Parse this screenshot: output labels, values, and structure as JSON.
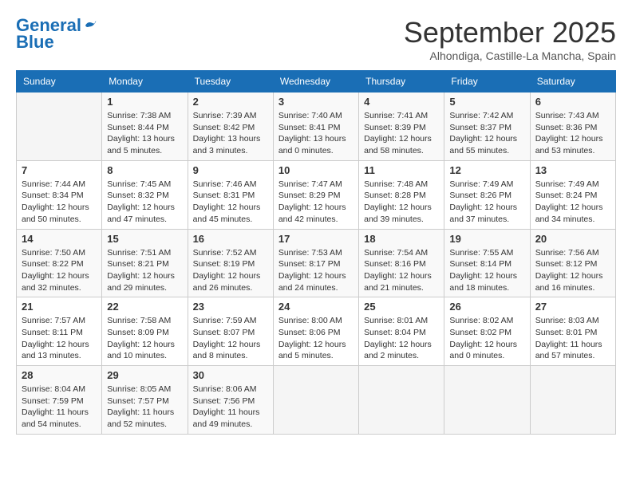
{
  "header": {
    "logo_line1": "General",
    "logo_line2": "Blue",
    "month": "September 2025",
    "location": "Alhondiga, Castille-La Mancha, Spain"
  },
  "weekdays": [
    "Sunday",
    "Monday",
    "Tuesday",
    "Wednesday",
    "Thursday",
    "Friday",
    "Saturday"
  ],
  "weeks": [
    [
      {
        "day": "",
        "info": ""
      },
      {
        "day": "1",
        "info": "Sunrise: 7:38 AM\nSunset: 8:44 PM\nDaylight: 13 hours\nand 5 minutes."
      },
      {
        "day": "2",
        "info": "Sunrise: 7:39 AM\nSunset: 8:42 PM\nDaylight: 13 hours\nand 3 minutes."
      },
      {
        "day": "3",
        "info": "Sunrise: 7:40 AM\nSunset: 8:41 PM\nDaylight: 13 hours\nand 0 minutes."
      },
      {
        "day": "4",
        "info": "Sunrise: 7:41 AM\nSunset: 8:39 PM\nDaylight: 12 hours\nand 58 minutes."
      },
      {
        "day": "5",
        "info": "Sunrise: 7:42 AM\nSunset: 8:37 PM\nDaylight: 12 hours\nand 55 minutes."
      },
      {
        "day": "6",
        "info": "Sunrise: 7:43 AM\nSunset: 8:36 PM\nDaylight: 12 hours\nand 53 minutes."
      }
    ],
    [
      {
        "day": "7",
        "info": "Sunrise: 7:44 AM\nSunset: 8:34 PM\nDaylight: 12 hours\nand 50 minutes."
      },
      {
        "day": "8",
        "info": "Sunrise: 7:45 AM\nSunset: 8:32 PM\nDaylight: 12 hours\nand 47 minutes."
      },
      {
        "day": "9",
        "info": "Sunrise: 7:46 AM\nSunset: 8:31 PM\nDaylight: 12 hours\nand 45 minutes."
      },
      {
        "day": "10",
        "info": "Sunrise: 7:47 AM\nSunset: 8:29 PM\nDaylight: 12 hours\nand 42 minutes."
      },
      {
        "day": "11",
        "info": "Sunrise: 7:48 AM\nSunset: 8:28 PM\nDaylight: 12 hours\nand 39 minutes."
      },
      {
        "day": "12",
        "info": "Sunrise: 7:49 AM\nSunset: 8:26 PM\nDaylight: 12 hours\nand 37 minutes."
      },
      {
        "day": "13",
        "info": "Sunrise: 7:49 AM\nSunset: 8:24 PM\nDaylight: 12 hours\nand 34 minutes."
      }
    ],
    [
      {
        "day": "14",
        "info": "Sunrise: 7:50 AM\nSunset: 8:22 PM\nDaylight: 12 hours\nand 32 minutes."
      },
      {
        "day": "15",
        "info": "Sunrise: 7:51 AM\nSunset: 8:21 PM\nDaylight: 12 hours\nand 29 minutes."
      },
      {
        "day": "16",
        "info": "Sunrise: 7:52 AM\nSunset: 8:19 PM\nDaylight: 12 hours\nand 26 minutes."
      },
      {
        "day": "17",
        "info": "Sunrise: 7:53 AM\nSunset: 8:17 PM\nDaylight: 12 hours\nand 24 minutes."
      },
      {
        "day": "18",
        "info": "Sunrise: 7:54 AM\nSunset: 8:16 PM\nDaylight: 12 hours\nand 21 minutes."
      },
      {
        "day": "19",
        "info": "Sunrise: 7:55 AM\nSunset: 8:14 PM\nDaylight: 12 hours\nand 18 minutes."
      },
      {
        "day": "20",
        "info": "Sunrise: 7:56 AM\nSunset: 8:12 PM\nDaylight: 12 hours\nand 16 minutes."
      }
    ],
    [
      {
        "day": "21",
        "info": "Sunrise: 7:57 AM\nSunset: 8:11 PM\nDaylight: 12 hours\nand 13 minutes."
      },
      {
        "day": "22",
        "info": "Sunrise: 7:58 AM\nSunset: 8:09 PM\nDaylight: 12 hours\nand 10 minutes."
      },
      {
        "day": "23",
        "info": "Sunrise: 7:59 AM\nSunset: 8:07 PM\nDaylight: 12 hours\nand 8 minutes."
      },
      {
        "day": "24",
        "info": "Sunrise: 8:00 AM\nSunset: 8:06 PM\nDaylight: 12 hours\nand 5 minutes."
      },
      {
        "day": "25",
        "info": "Sunrise: 8:01 AM\nSunset: 8:04 PM\nDaylight: 12 hours\nand 2 minutes."
      },
      {
        "day": "26",
        "info": "Sunrise: 8:02 AM\nSunset: 8:02 PM\nDaylight: 12 hours\nand 0 minutes."
      },
      {
        "day": "27",
        "info": "Sunrise: 8:03 AM\nSunset: 8:01 PM\nDaylight: 11 hours\nand 57 minutes."
      }
    ],
    [
      {
        "day": "28",
        "info": "Sunrise: 8:04 AM\nSunset: 7:59 PM\nDaylight: 11 hours\nand 54 minutes."
      },
      {
        "day": "29",
        "info": "Sunrise: 8:05 AM\nSunset: 7:57 PM\nDaylight: 11 hours\nand 52 minutes."
      },
      {
        "day": "30",
        "info": "Sunrise: 8:06 AM\nSunset: 7:56 PM\nDaylight: 11 hours\nand 49 minutes."
      },
      {
        "day": "",
        "info": ""
      },
      {
        "day": "",
        "info": ""
      },
      {
        "day": "",
        "info": ""
      },
      {
        "day": "",
        "info": ""
      }
    ]
  ]
}
